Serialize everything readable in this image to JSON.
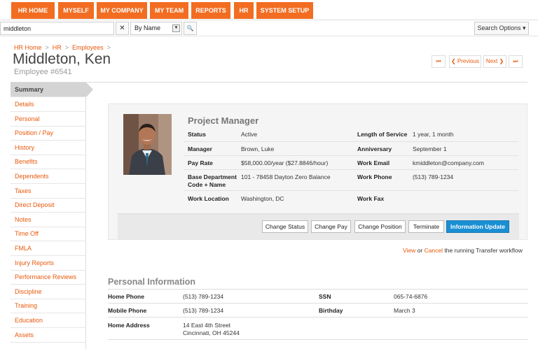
{
  "nav": [
    "HR HOME",
    "MYSELF",
    "MY COMPANY",
    "MY TEAM",
    "REPORTS",
    "HR",
    "SYSTEM SETUP"
  ],
  "search": {
    "value": "middleton",
    "clear_label": "✕",
    "mode": "By Name",
    "go_label": "🔍",
    "options_label": "Search Options ▾"
  },
  "breadcrumb": [
    "HR Home",
    "HR",
    "Employees"
  ],
  "employee": {
    "name": "Middleton, Ken",
    "number": "Employee #6541",
    "title": "Project Manager"
  },
  "pager": {
    "first": "⏮",
    "previous": "❮  Previous",
    "next": "Next  ❯",
    "last": "⏭"
  },
  "sidebar": [
    "Summary",
    "Details",
    "Personal",
    "Position / Pay",
    "History",
    "Benefits",
    "Dependents",
    "Taxes",
    "Direct Deposit",
    "Notes",
    "Time Off",
    "FMLA",
    "Injury Reports",
    "Performance Reviews",
    "Discipline",
    "Training",
    "Education",
    "Assets"
  ],
  "details": {
    "status_label": "Status",
    "status": "Active",
    "manager_label": "Manager",
    "manager": "Brown, Luke",
    "payrate_label": "Pay Rate",
    "payrate": "$58,000.00/year  ($27.8846/hour)",
    "dept_label_1": "Base Department",
    "dept_label_2": "Code + Name",
    "dept": "101 - 78458 Dayton Zero Balance",
    "location_label": "Work Location",
    "location": "Washington, DC",
    "service_label": "Length of Service",
    "service": "1 year, 1 month",
    "anniversary_label": "Anniversary",
    "anniversary": "September 1",
    "email_label": "Work Email",
    "email": "kmiddleton@company.com",
    "phone_label": "Work Phone",
    "phone": "(513) 789-1234",
    "fax_label": "Work Fax",
    "fax": ""
  },
  "actions": [
    "Change Status",
    "Change Pay",
    "Change Position",
    "Terminate",
    "Information Update"
  ],
  "workflow": {
    "view": "View",
    "or": " or ",
    "cancel": "Cancel",
    "rest": " the running Transfer workflow"
  },
  "personal": {
    "title": "Personal Information",
    "home_phone_label": "Home Phone",
    "home_phone": "(513) 789-1234",
    "mobile_label": "Mobile Phone",
    "mobile": "(513) 789-1234",
    "address_label": "Home Address",
    "address_1": "14 East 4th Street",
    "address_2": "Cincinnati, OH 45244",
    "ssn_label": "SSN",
    "ssn": "065-74-6876",
    "birthday_label": "Birthday",
    "birthday": "March 3"
  },
  "colors": {
    "accent": "#f26d21",
    "link": "#e8590c",
    "primary_button": "#1a8fd3"
  }
}
